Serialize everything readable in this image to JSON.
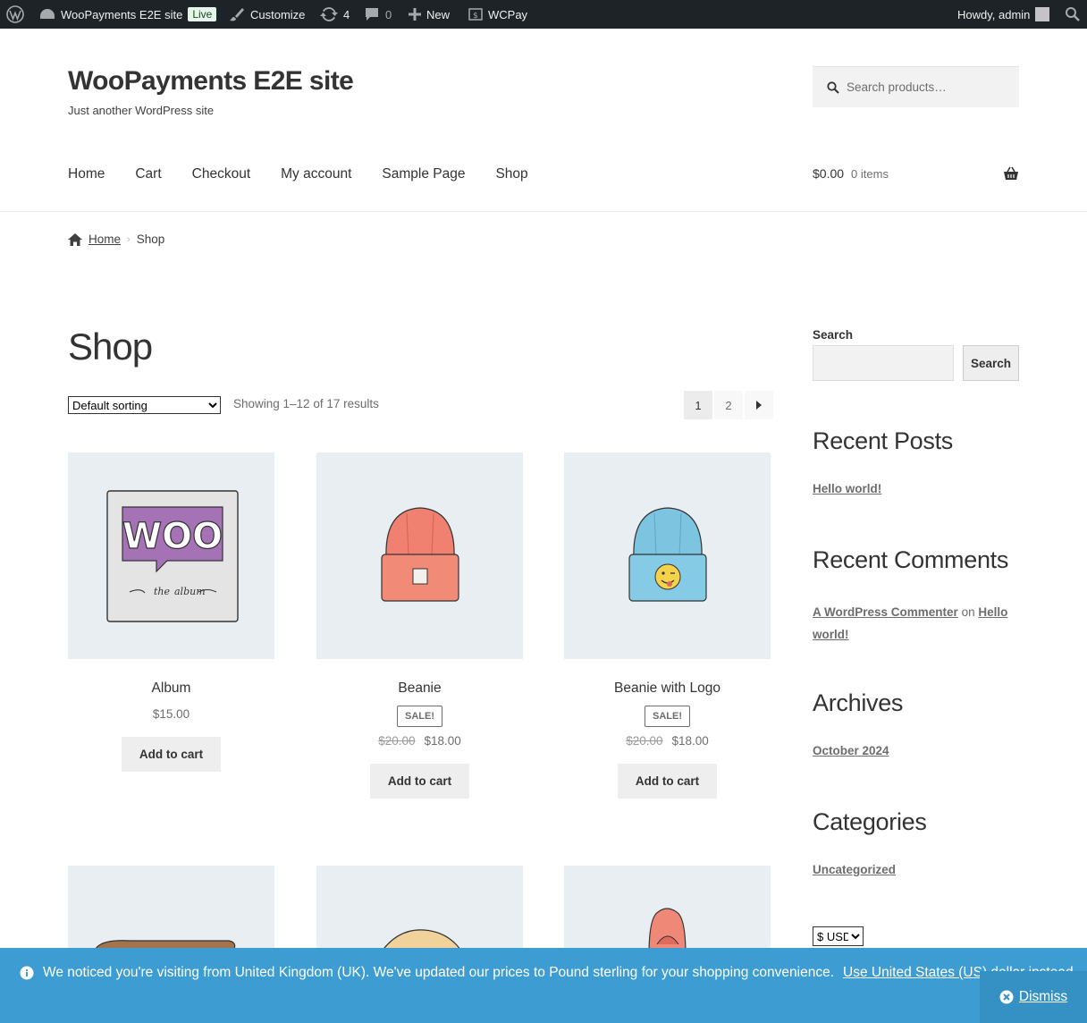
{
  "adminbar": {
    "site_name": "WooPayments E2E site",
    "live_badge": "Live",
    "customize": "Customize",
    "updates_count": "4",
    "comments_count": "0",
    "new": "New",
    "wcpay": "WCPay",
    "howdy": "Howdy, admin"
  },
  "header": {
    "title": "WooPayments E2E site",
    "tagline": "Just another WordPress site",
    "search_placeholder": "Search products…",
    "nav": [
      "Home",
      "Cart",
      "Checkout",
      "My account",
      "Sample Page",
      "Shop"
    ],
    "cart_total": "$0.00",
    "cart_items": "0 items"
  },
  "breadcrumb": {
    "home": "Home",
    "current": "Shop"
  },
  "main": {
    "title": "Shop",
    "sorting": "Default sorting",
    "result_count": "Showing 1–12 of 17 results",
    "pages": [
      "1",
      "2"
    ]
  },
  "products": [
    {
      "name": "Album",
      "price": "$15.00",
      "button": "Add to cart"
    },
    {
      "name": "Beanie",
      "sale": "SALE!",
      "old_price": "$20.00",
      "price": "$18.00",
      "button": "Add to cart"
    },
    {
      "name": "Beanie with Logo",
      "sale": "SALE!",
      "old_price": "$20.00",
      "price": "$18.00",
      "button": "Add to cart"
    }
  ],
  "sidebar": {
    "search_label": "Search",
    "search_button": "Search",
    "recent_posts": "Recent Posts",
    "post_link": "Hello world!",
    "recent_comments": "Recent Comments",
    "commenter": "A WordPress Commenter",
    "on": "on",
    "comment_post": "Hello world!",
    "archives": "Archives",
    "archive_link": "October 2024",
    "categories": "Categories",
    "category_link": "Uncategorized",
    "currency": "$ USD"
  },
  "notice": {
    "text": "We noticed you're visiting from United Kingdom (UK). We've updated our prices to Pound sterling for your shopping convenience.",
    "link": "Use United States (US) dollar instead.",
    "dismiss": "Dismiss"
  },
  "colors": {
    "adminbar": "#1d2327",
    "notice": "#3d9cd2",
    "thumb_bg": "#e9eef2"
  }
}
